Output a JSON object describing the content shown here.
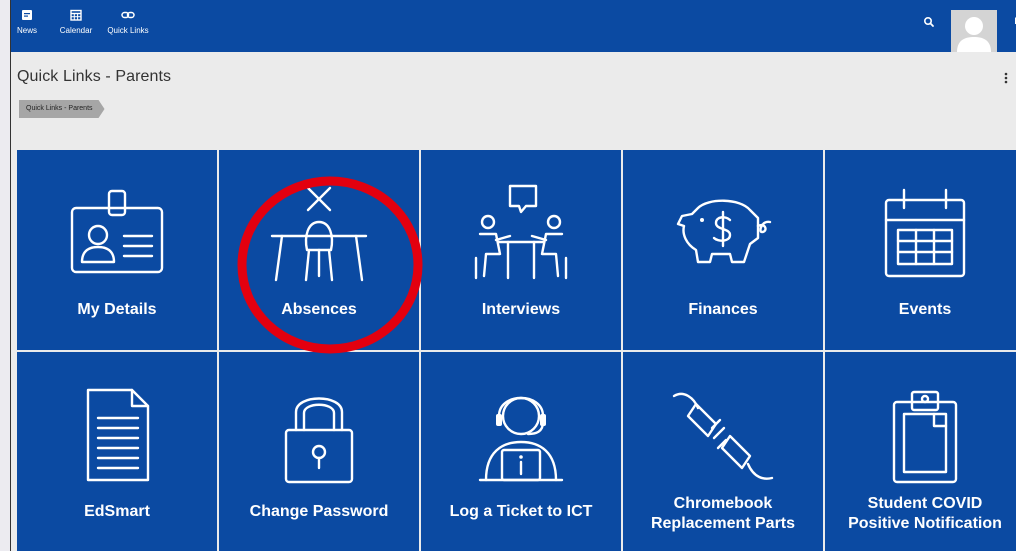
{
  "nav": {
    "items": [
      {
        "label": "News",
        "icon": "news-icon"
      },
      {
        "label": "Calendar",
        "icon": "calendar-icon"
      },
      {
        "label": "Quick Links",
        "icon": "link-icon"
      }
    ]
  },
  "header": {
    "title": "Quick Links - Parents",
    "breadcrumb": "Quick Links - Parents"
  },
  "tiles": [
    {
      "label": "My Details",
      "icon": "id-card-icon"
    },
    {
      "label": "Absences",
      "icon": "empty-desk-icon"
    },
    {
      "label": "Interviews",
      "icon": "interview-icon"
    },
    {
      "label": "Finances",
      "icon": "piggy-bank-icon"
    },
    {
      "label": "Events",
      "icon": "calendar-icon"
    },
    {
      "label": "EdSmart",
      "icon": "document-icon"
    },
    {
      "label": "Change Password",
      "icon": "padlock-icon"
    },
    {
      "label": "Log a Ticket to ICT",
      "icon": "helpdesk-icon"
    },
    {
      "label": "Chromebook Replacement Parts",
      "line1": "Chromebook",
      "line2": "Replacement Parts",
      "icon": "plug-icon"
    },
    {
      "label": "Student COVID Positive Notification",
      "line1": "Student COVID",
      "line2": "Positive Notification",
      "icon": "clipboard-icon"
    }
  ],
  "colors": {
    "brand": "#0b4aa2",
    "background": "#ebebeb",
    "highlight": "#e3000f"
  }
}
